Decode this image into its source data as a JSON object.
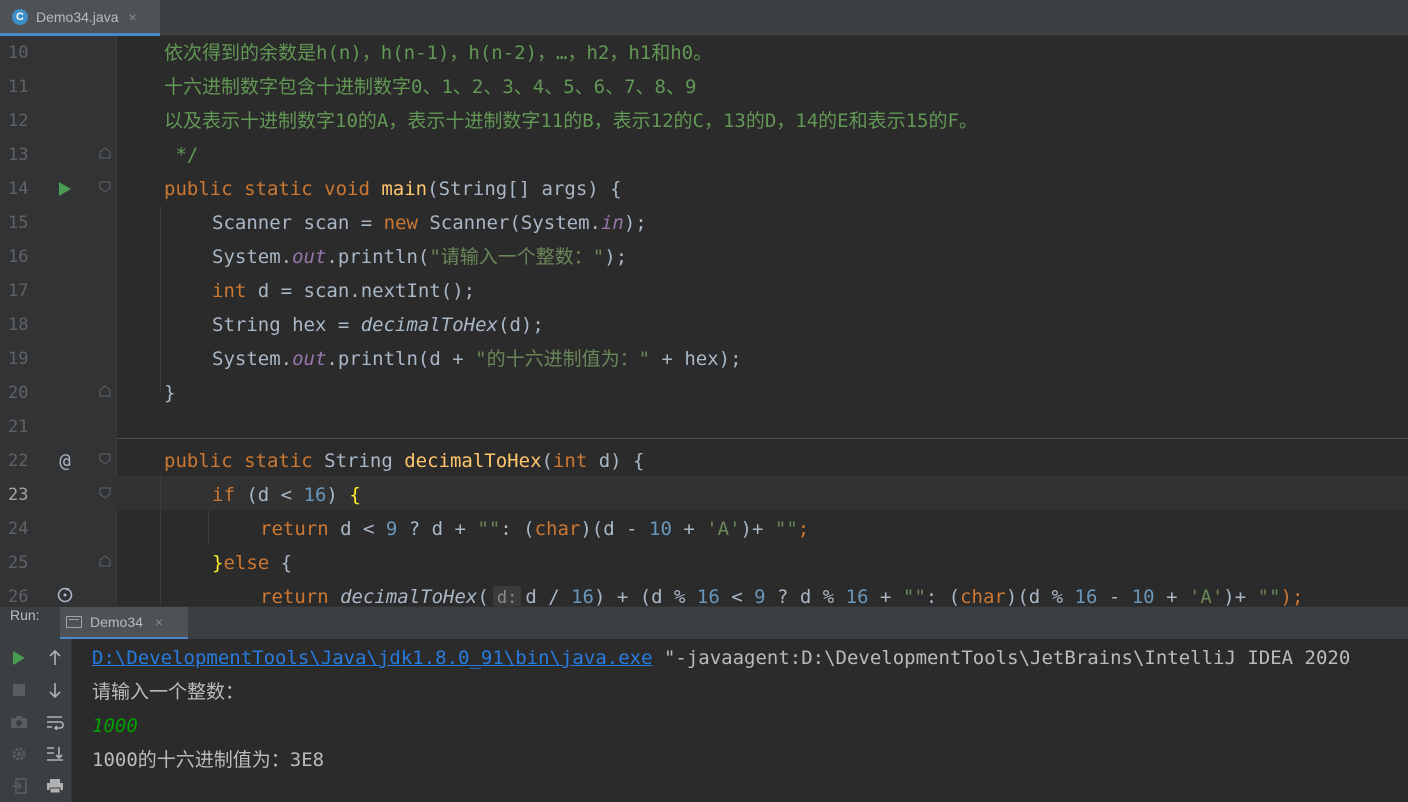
{
  "editor_tab": {
    "label": "Demo34.java",
    "icon_letter": "C",
    "close": "×"
  },
  "gutter": {
    "line_numbers": [
      "10",
      "11",
      "12",
      "13",
      "14",
      "15",
      "16",
      "17",
      "18",
      "19",
      "20",
      "21",
      "22",
      "23",
      "24",
      "25",
      "26"
    ],
    "current_line": "23",
    "markers": {
      "run": "▶",
      "implementing": "@",
      "recursive_call": "recursion-icon"
    }
  },
  "code": {
    "l10": "依次得到的余数是h(n)，h(n-1)，h(n-2)，…，h2，h1和h0。",
    "l11": "十六进制数字包含十进制数字0、1、2、3、4、5、6、7、8、9",
    "l12": "以及表示十进制数字10的A，表示十进制数字11的B，表示12的C，13的D，14的E和表示15的F。",
    "l13": " */",
    "l14": {
      "mod": "public static void",
      "name": "main",
      "rest": "(String[] args) {"
    },
    "l15": {
      "a": "Scanner scan = ",
      "kw": "new",
      "b": " Scanner(System.",
      "field": "in",
      "c": ");"
    },
    "l16": {
      "a": "System.",
      "field": "out",
      "b": ".println(",
      "str": "\"请输入一个整数：\"",
      "c": ");"
    },
    "l17": {
      "kw": "int",
      "a": " d = scan.nextInt();"
    },
    "l18": {
      "a": "String hex = ",
      "call": "decimalToHex",
      "b": "(d);"
    },
    "l19": {
      "a": "System.",
      "field": "out",
      "b": ".println(d + ",
      "str": "\"的十六进制值为：\"",
      "c": " + hex);"
    },
    "l20": "}",
    "l22": {
      "mod": "public static",
      "type": " String ",
      "name": "decimalToHex",
      "p1": "(",
      "kw": "int",
      "p2": " d) {"
    },
    "l23": {
      "kw": "if",
      "a": " (d < ",
      "num": "16",
      "b": ") ",
      "brace": "{"
    },
    "l24": {
      "kw": "return",
      "a": " d < ",
      "n1": "9",
      "b": " ? d + ",
      "s1": "\"\"",
      "c": ": (",
      "kw2": "char",
      "d": ")(d - ",
      "n2": "10",
      "e": " + ",
      "s2": "'A'",
      "f": ")+ ",
      "s3": "\"\"",
      "g": ";"
    },
    "l25": {
      "brace": "}",
      "kw": "else",
      "a": " {"
    },
    "l26": {
      "kw": "return",
      "call": "decimalToHex",
      "p": "(",
      "hint": "d:",
      "a": "d / ",
      "n1": "16",
      "b": ") + (d % ",
      "n2": "16",
      "c": " < ",
      "n3": "9",
      "d": " ? d % ",
      "n4": "16",
      "e": " + ",
      "s1": "\"\"",
      "f": ": (",
      "kw2": "char",
      "g": ")(d % ",
      "n5": "16",
      "h": " - ",
      "n6": "10",
      "i": " + ",
      "s2": "'A'",
      "j": ")+ ",
      "s3": "\"\"",
      "k": ");"
    }
  },
  "run_panel": {
    "label": "Run:",
    "tab_label": "Demo34",
    "tab_close": "×",
    "toolbar": [
      "rerun-icon",
      "stop-icon",
      "camera-icon",
      "settings-icon",
      "exit-icon",
      "up-arrow-icon",
      "down-arrow-icon",
      "soft-wrap-icon",
      "scroll-to-end-icon",
      "print-icon"
    ],
    "console": {
      "exe_path": "D:\\DevelopmentTools\\Java\\jdk1.8.0_91\\bin\\java.exe",
      "args": " \"-javaagent:D:\\DevelopmentTools\\JetBrains\\IntelliJ IDEA 2020",
      "prompt": "请输入一个整数：",
      "input": "1000",
      "output": "1000的十六进制值为：3E8"
    }
  },
  "colors": {
    "background": "#2b2b2b",
    "keyword": "#cc7832",
    "function": "#ffc66d",
    "number": "#6897bb",
    "string": "#6a8759",
    "comment": "#629755",
    "field": "#9876aa",
    "link": "#287bde",
    "input": "#00a000"
  }
}
